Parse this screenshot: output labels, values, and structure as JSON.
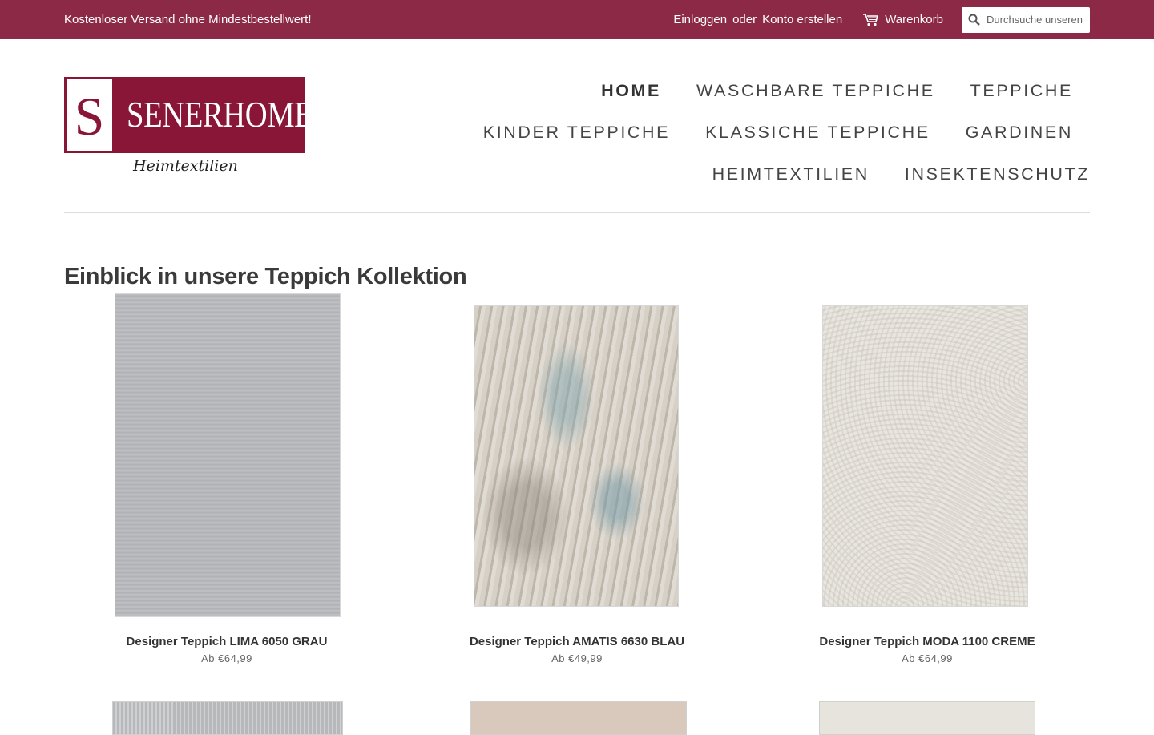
{
  "announcement": {
    "text": "Kostenloser Versand ohne Mindestbestellwert!"
  },
  "account": {
    "login": "Einloggen",
    "or": "oder",
    "register": "Konto erstellen"
  },
  "cart": {
    "label": "Warenkorb"
  },
  "search": {
    "placeholder": "Durchsuche unseren Shop"
  },
  "brand": {
    "letter": "S",
    "name": "SENERHOME",
    "tagline": "Heimtextilien",
    "color": "#8a1637"
  },
  "theme": {
    "topbar_color": "#8b2946"
  },
  "nav": {
    "items": [
      {
        "label": "HOME",
        "active": true
      },
      {
        "label": "WASCHBARE TEPPICHE"
      },
      {
        "label": "TEPPICHE"
      },
      {
        "label": "KINDER TEPPICHE"
      },
      {
        "label": "KLASSICHE TEPPICHE"
      },
      {
        "label": "GARDINEN"
      },
      {
        "label": "HEIMTEXTILIEN"
      },
      {
        "label": "INSEKTENSCHUTZ"
      }
    ]
  },
  "collection": {
    "title": "Einblick in unsere Teppich Kollektion",
    "products": [
      {
        "name": "Designer Teppich LIMA 6050 GRAU",
        "price": "Ab €64,99"
      },
      {
        "name": "Designer Teppich AMATIS 6630 BLAU",
        "price": "Ab €49,99"
      },
      {
        "name": "Designer Teppich MODA 1100 CREME",
        "price": "Ab €64,99"
      }
    ]
  }
}
